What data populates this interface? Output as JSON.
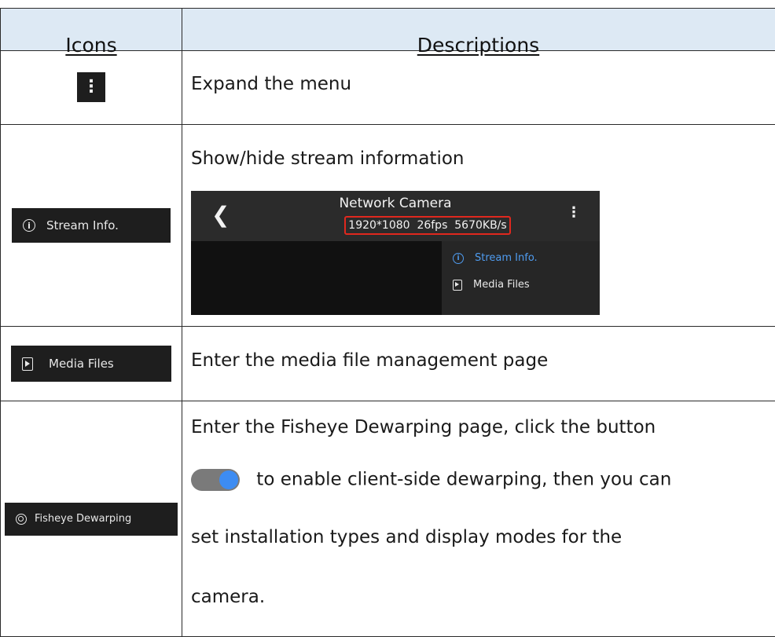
{
  "header": {
    "icons": "Icons",
    "descriptions": "Descriptions"
  },
  "rows": [
    {
      "icon": "more-vertical-icon",
      "description": "Expand the menu"
    },
    {
      "icon_label": "Stream Info.",
      "description": "Show/hide stream information",
      "screenshot": {
        "back_glyph": "❮",
        "title": "Network Camera",
        "stats": "1920*1080  26fps  5670KB/s",
        "menu_items": [
          "Stream Info.",
          "Media Files"
        ]
      }
    },
    {
      "icon_label": "Media Files",
      "description": "Enter the media file management page"
    },
    {
      "icon_label": "Fisheye Dewarping",
      "lines": [
        "Enter the Fisheye Dewarping page, click the button",
        " to enable client-side dewarping, then you can",
        "set installation types and display modes for the",
        "camera."
      ]
    }
  ],
  "colors": {
    "header_bg": "#dde9f4",
    "highlight_border": "#e0281e",
    "accent_blue": "#4f9cf0",
    "chip_bg": "#1e1e1e"
  }
}
